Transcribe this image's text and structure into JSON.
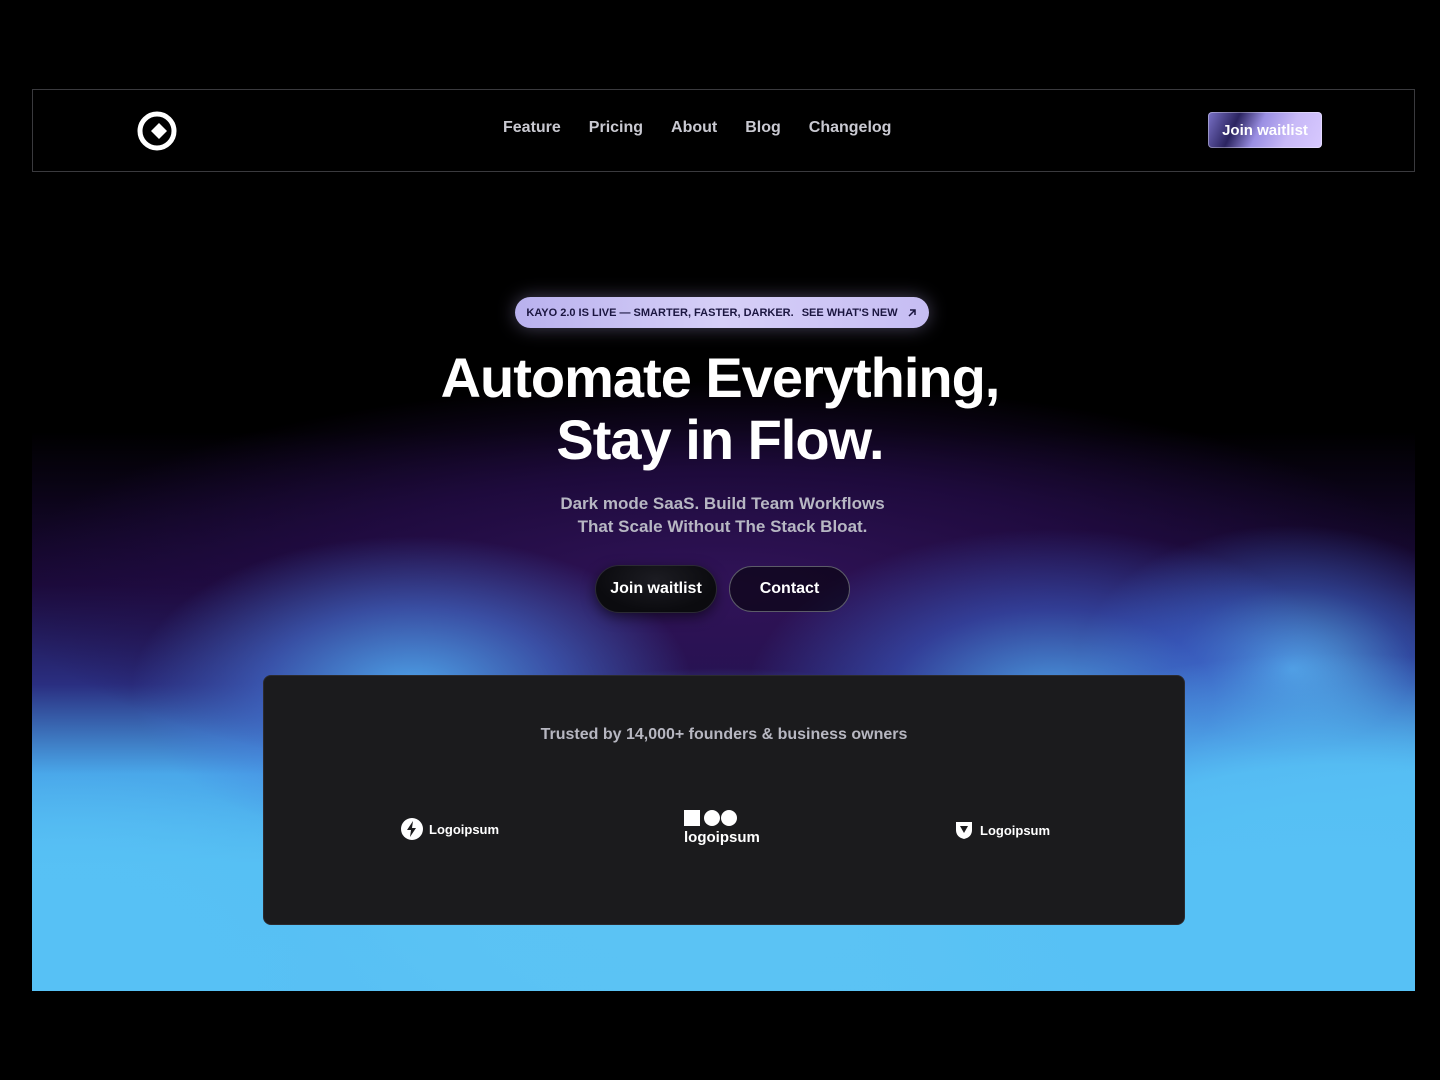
{
  "nav": {
    "links": [
      "Feature",
      "Pricing",
      "About",
      "Blog",
      "Changelog"
    ],
    "cta_label": "Join waitlist"
  },
  "announcement": {
    "text": "KAYO 2.0 IS LIVE — SMARTER, FASTER, DARKER.",
    "link": "SEE WHAT'S NEW",
    "icon": "arrow-up-right-icon"
  },
  "hero": {
    "headline_line1": "Automate Everything,",
    "headline_line2": "Stay in Flow.",
    "sub_line1": "Dark mode SaaS. Build Team Workflows",
    "sub_line2": "That Scale Without The Stack Bloat.",
    "primary_label": "Join waitlist",
    "secondary_label": "Contact"
  },
  "trust": {
    "text": "Trusted by 14,000+ founders & business owners",
    "brands": [
      "Logoipsum",
      "logoipsum",
      "Logoipsum"
    ]
  },
  "colors": {
    "accent_lilac": "#c8b9f7",
    "glow_blue": "#57c1f5",
    "glow_purple": "#2a0f55",
    "card_bg": "#1b1b1d"
  }
}
